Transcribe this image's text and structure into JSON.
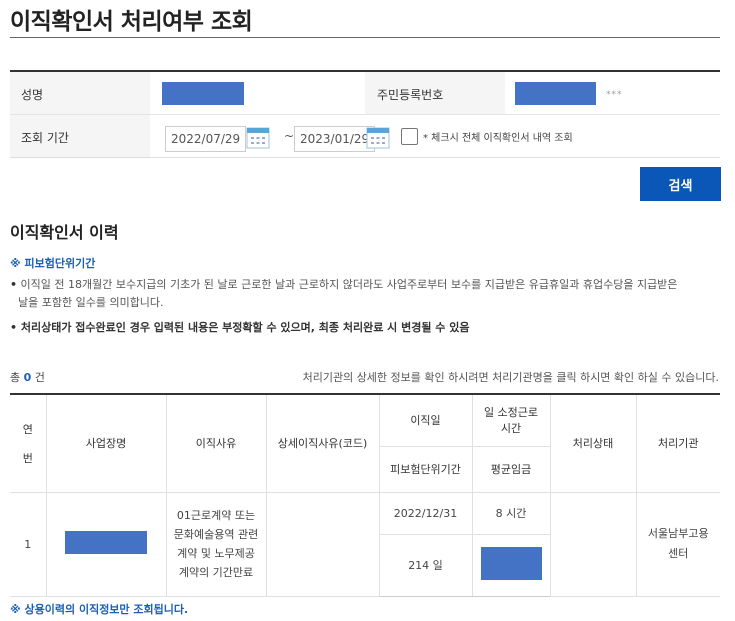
{
  "page": {
    "title": "이직확인서 처리여부 조회"
  },
  "form": {
    "name_label": "성명",
    "ssn_label": "주민등록번호",
    "ssn_suffix": "***",
    "period_label": "조회 기간",
    "date_from": "2022/07/29",
    "date_to": "2023/01/29",
    "range_separator": "~",
    "all_history_note": "* 체크시 전체 이직확인서 내역 조회",
    "all_history_checked": false
  },
  "search_button": "검색",
  "history": {
    "title": "이직확인서 이력",
    "note_heading": "※ 피보험단위기간",
    "bullets": [
      {
        "dot": "•",
        "text": " 이직일 전 18개월간 보수지급의 기초가 된 날로 근로한 날과 근로하지 않더라도 사업주로부터 보수를 지급받은 유급휴일과 휴업수당을 지급받은",
        "cont": "날을 포함한 일수를 의미합니다."
      },
      {
        "dot": "•",
        "text": " 처리상태가 접수완료인 경우 입력된 내용은 부정확할 수 있으며, 최종 처리완료 시 변경될 수 있음"
      }
    ],
    "count_prefix": "총 ",
    "count_value": "0",
    "count_suffix": " 건",
    "hint": "처리기관의 상세한 정보를 확인 하시려면 처리기관명을 클릭 하시면 확인 하실 수 있습니다."
  },
  "table": {
    "headers": {
      "no_line1": "연",
      "no_line2": "번",
      "workplace": "사업장명",
      "reason": "이직사유",
      "detail_reason": "상세이직사유(코드)",
      "leave_date": "이직일",
      "insured_period": "피보험단위기간",
      "daily_hours_line1": "일 소정근로",
      "daily_hours_line2": "시간",
      "avg_wage": "평균임금",
      "status": "처리상태",
      "agency": "처리기관"
    },
    "rows": [
      {
        "no": "1",
        "reason_lines": [
          "01근로계약 또는",
          "문화예술용역 관련",
          "계약 및 노무제공",
          "계약의 기간만료"
        ],
        "detail_reason": "",
        "leave_date": "2022/12/31",
        "daily_hours": "8 시간",
        "insured_days": "214 일",
        "status": "",
        "agency_line1": "서울남부고용",
        "agency_line2": "센터"
      }
    ]
  },
  "footnote": "※ 상용이력의 이직정보만 조회됩니다.",
  "colors": {
    "accent": "#0a57b8",
    "mask": "#4472c4",
    "note_blue": "#1a5fb4"
  }
}
